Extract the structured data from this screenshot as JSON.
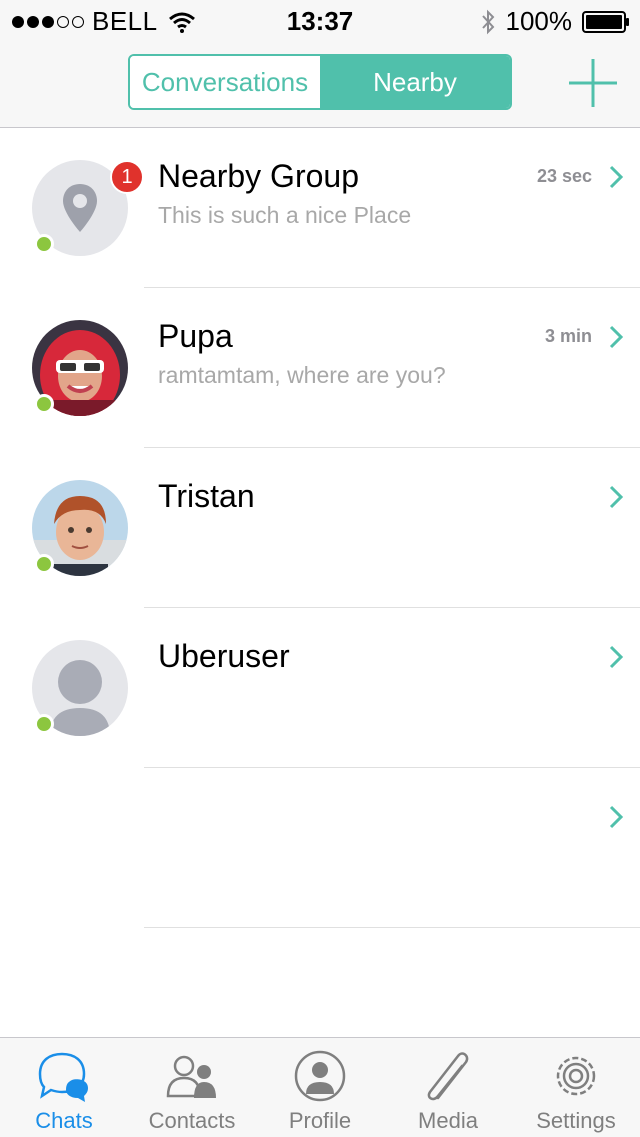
{
  "status_bar": {
    "carrier": "BELL",
    "time": "13:37",
    "battery": "100%"
  },
  "nav": {
    "segments": [
      "Conversations",
      "Nearby"
    ],
    "active_segment": "Nearby",
    "add_icon": "plus-icon"
  },
  "chats": [
    {
      "name": "Nearby Group",
      "preview": "This is such a nice Place",
      "time": "23 sec",
      "badge": "1",
      "avatar": "location-pin-icon",
      "online": true
    },
    {
      "name": "Pupa",
      "preview": "ramtamtam, where are you?",
      "time": "3 min",
      "badge": "",
      "avatar": "photo",
      "online": true
    },
    {
      "name": "Tristan",
      "preview": "",
      "time": "",
      "badge": "",
      "avatar": "photo",
      "online": true
    },
    {
      "name": "Uberuser",
      "preview": "",
      "time": "",
      "badge": "",
      "avatar": "default-user-icon",
      "online": true
    },
    {
      "name": "",
      "preview": "",
      "time": "",
      "badge": "",
      "avatar": "",
      "online": false
    }
  ],
  "tabs": [
    {
      "label": "Chats",
      "icon": "chat-bubbles-icon",
      "active": true
    },
    {
      "label": "Contacts",
      "icon": "contacts-icon",
      "active": false
    },
    {
      "label": "Profile",
      "icon": "profile-icon",
      "active": false
    },
    {
      "label": "Media",
      "icon": "paperclip-icon",
      "active": false
    },
    {
      "label": "Settings",
      "icon": "gear-icon",
      "active": false
    }
  ],
  "colors": {
    "accent": "#50c0ab",
    "tab_active": "#1a8ee8",
    "badge": "#e0322c",
    "online": "#8cc63f"
  }
}
